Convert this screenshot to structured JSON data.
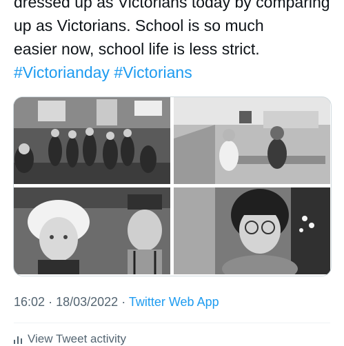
{
  "tweet": {
    "text_line_1": "dressed up as Victorians today by comparing",
    "text_line_2": "up as Victorians. School is so much",
    "text_line_3": "easier now, school life is less strict.",
    "hashtag_1": "#Victorianday",
    "hashtag_2": "#Victorians"
  },
  "media": {
    "photos": [
      "classroom-group-photo",
      "children-at-desks-photo",
      "girl-in-bonnet-photo",
      "girl-with-glasses-photo"
    ]
  },
  "meta": {
    "time": "16:02",
    "separator": "·",
    "date": "18/03/2022",
    "source": "Twitter Web App"
  },
  "activity": {
    "label": "View Tweet activity",
    "icon": "bar-chart-icon"
  },
  "colors": {
    "accent": "#1d9bf0",
    "text": "#0f1419",
    "muted": "#536471"
  }
}
